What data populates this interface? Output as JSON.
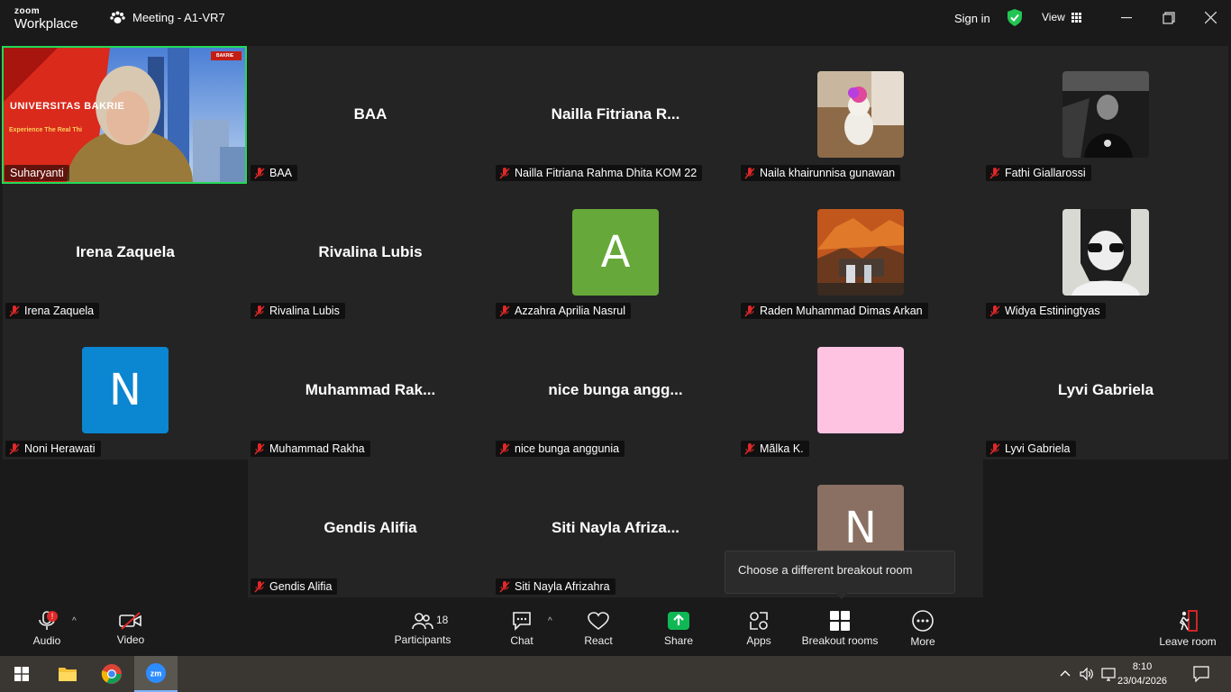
{
  "app": {
    "brand_top": "zoom",
    "brand_bottom": "Workplace",
    "meeting_title": "Meeting - A1-VR7"
  },
  "header": {
    "sign_in": "Sign in",
    "view": "View"
  },
  "speaker": {
    "name": "Suharyanti",
    "slide_title": "UNIVERSITAS BAKRIE",
    "slide_tagline": "Experience The Real Thi",
    "slide_logo": "BAKRIE"
  },
  "tiles": [
    {
      "display": "BAA",
      "label": "BAA"
    },
    {
      "display": "Nailla  Fitriana  R...",
      "label": "Nailla Fitriana Rahma Dhita KOM 22"
    },
    {
      "label": "Naila khairunnisa gunawan"
    },
    {
      "label": "Fathi Giallarossi"
    },
    {
      "display": "Irena Zaquela",
      "label": "Irena Zaquela"
    },
    {
      "display": "Rivalina Lubis",
      "label": "Rivalina Lubis"
    },
    {
      "letter": "A",
      "label": "Azzahra Aprilia Nasrul"
    },
    {
      "label": "Raden Muhammad Dimas Arkan"
    },
    {
      "label": "Widya Estiningtyas"
    },
    {
      "letter": "N",
      "label": "Noni Herawati"
    },
    {
      "display": "Muhammad  Rak...",
      "label": "Muhammad Rakha"
    },
    {
      "display": "nice bunga angg...",
      "label": "nice bunga anggunia"
    },
    {
      "label": "Mãlka K."
    },
    {
      "display": "Lyvi Gabriela",
      "label": "Lyvi Gabriela"
    },
    {
      "display": "Gendis Alifia",
      "label": "Gendis Alifia"
    },
    {
      "display": "Siti  Nayla  Afriza...",
      "label": "Siti Nayla Afrizahra"
    },
    {
      "letter": "N"
    }
  ],
  "tooltip": "Choose a different breakout room",
  "toolbar": {
    "audio": "Audio",
    "audio_badge": "!",
    "video": "Video",
    "participants": "Participants",
    "participants_count": "18",
    "chat": "Chat",
    "react": "React",
    "share": "Share",
    "apps": "Apps",
    "breakout": "Breakout rooms",
    "more": "More",
    "leave": "Leave room"
  },
  "taskbar": {
    "time": "8:10",
    "date": "23/04/2026"
  },
  "colors": {
    "speaker_border": "#23d959",
    "share_green": "#0fb855",
    "avatar_A": "#66a83a",
    "avatar_N_blue": "#0b86d1",
    "avatar_pink": "#ffc3e2",
    "avatar_N_brown": "#8a7062"
  }
}
